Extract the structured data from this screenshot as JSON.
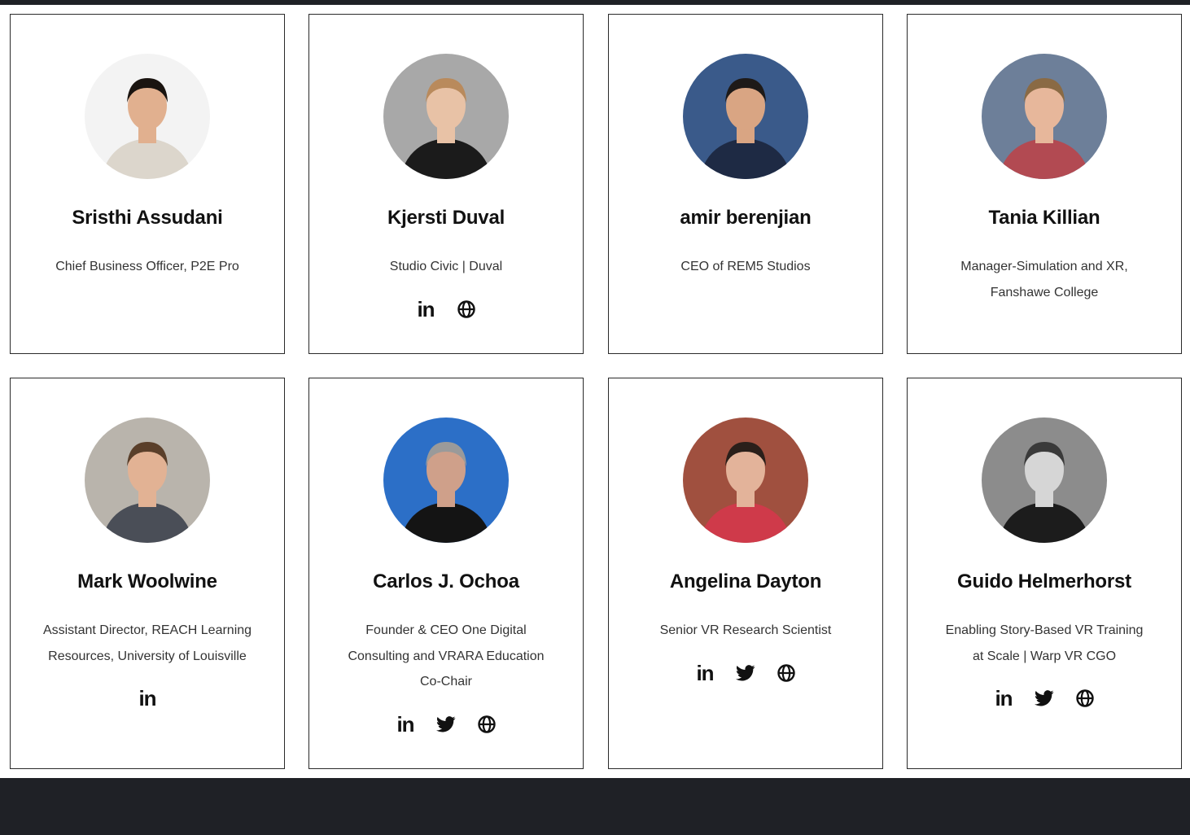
{
  "people": [
    {
      "name": "Sristhi Assudani",
      "role_lines": [
        "Chief Business Officer, P2E Pro"
      ],
      "avatar_bg": "#f3f3f3",
      "socials": []
    },
    {
      "name": "Kjersti Duval",
      "role_lines": [
        "Studio Civic | Duval"
      ],
      "avatar_bg": "#a8a8a8",
      "socials": [
        "linkedin-icon",
        "globe-icon"
      ]
    },
    {
      "name": "amir berenjian",
      "role_lines": [
        "CEO of REM5 Studios"
      ],
      "avatar_bg": "#3a5a8a",
      "socials": []
    },
    {
      "name": "Tania Killian",
      "role_lines": [
        "Manager-Simulation and XR,",
        "Fanshawe College"
      ],
      "avatar_bg": "#6d7f99",
      "socials": []
    },
    {
      "name": "Mark Woolwine",
      "role_lines": [
        "Assistant Director, REACH Learning",
        "Resources, University of Louisville"
      ],
      "avatar_bg": "#b9b4ac",
      "socials": [
        "linkedin-icon"
      ]
    },
    {
      "name": "Carlos J. Ochoa",
      "role_lines": [
        "Founder & CEO One Digital",
        "Consulting and VRARA Education",
        "Co-Chair"
      ],
      "avatar_bg": "#2c6fc7",
      "socials": [
        "linkedin-icon",
        "twitter-icon",
        "globe-icon"
      ]
    },
    {
      "name": "Angelina Dayton",
      "role_lines": [
        "Senior VR Research Scientist"
      ],
      "avatar_bg": "#a0503f",
      "socials": [
        "linkedin-icon",
        "twitter-icon",
        "globe-icon"
      ]
    },
    {
      "name": "Guido Helmerhorst",
      "role_lines": [
        "Enabling Story-Based VR Training",
        "at Scale | Warp VR CGO"
      ],
      "avatar_bg": "#8c8c8c",
      "socials": [
        "linkedin-icon",
        "twitter-icon",
        "globe-icon"
      ]
    }
  ],
  "linkedin_label": "in",
  "colors": {
    "dark": "#1f2126",
    "border": "#2a2a2a",
    "text": "#111111",
    "muted": "#333333"
  }
}
